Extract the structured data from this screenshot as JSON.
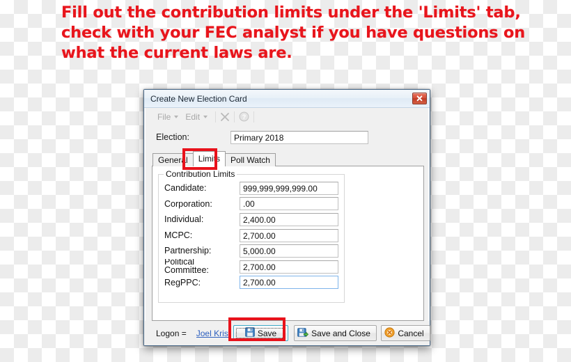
{
  "annotation": {
    "lines": [
      "Fill out the contribution limits under the 'Limits' tab,",
      "check with your FEC analyst if you have questions on",
      "what the current laws are."
    ],
    "color": "#e8151c",
    "highlight_color": "#e8121b",
    "highlighted_targets": [
      "Limits tab",
      "Save button"
    ]
  },
  "window": {
    "title": "Create New Election Card",
    "close_button": "close-icon",
    "toolbar": {
      "file_menu": "File",
      "edit_menu": "Edit",
      "delete_icon": "delete-x-icon",
      "help_icon": "help-question-icon"
    },
    "election": {
      "label": "Election:",
      "value": "Primary 2018",
      "placeholder": ""
    },
    "tabs": [
      {
        "label": "General",
        "active": false
      },
      {
        "label": "Limits",
        "active": true
      },
      {
        "label": "Poll Watch",
        "active": false
      }
    ],
    "limits_panel": {
      "group_title": "Contribution Limits",
      "fields": [
        {
          "label": "Candidate:",
          "value": "999,999,999,999.00",
          "focused": false,
          "two_line": false
        },
        {
          "label": "Corporation:",
          "value": ".00",
          "focused": false,
          "two_line": false
        },
        {
          "label": "Individual:",
          "value": "2,400.00",
          "focused": false,
          "two_line": false
        },
        {
          "label": "MCPC:",
          "value": "2,700.00",
          "focused": false,
          "two_line": false
        },
        {
          "label": "Partnership:",
          "value": "5,000.00",
          "focused": false,
          "two_line": false
        },
        {
          "label_line1": "Political",
          "label_line2": "Committee:",
          "label": "Political Committee:",
          "value": "2,700.00",
          "focused": false,
          "two_line": true
        },
        {
          "label": "RegPPC:",
          "value": "2,700.00",
          "focused": true,
          "two_line": false
        }
      ]
    },
    "footer": {
      "logon_label": "Logon =",
      "logon_user": "Joel Krist",
      "buttons": [
        {
          "label": "Save",
          "icon": "floppy-disk-icon",
          "focused": true
        },
        {
          "label": "Save and Close",
          "icon": "floppy-disk-arrow-icon",
          "focused": false
        },
        {
          "label": "Cancel",
          "icon": "cancel-circle-x-icon",
          "focused": false
        }
      ]
    }
  }
}
